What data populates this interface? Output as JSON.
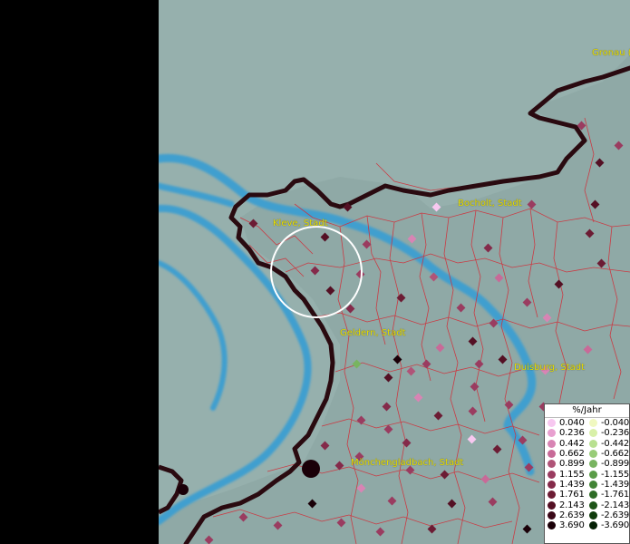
{
  "cities": [
    {
      "name": "Gronau (",
      "pos": "top-right"
    },
    {
      "name": "Bocholt, Stadt"
    },
    {
      "name": "Kleve, Stadt"
    },
    {
      "name": "Geldern, Stadt"
    },
    {
      "name": "Duisburg, Stadt"
    },
    {
      "name": "Mönchengladbach, Stadt"
    }
  ],
  "legend": {
    "title": "%/Jahr",
    "positive": [
      {
        "label": "0.040",
        "color": "#f7c8f0"
      },
      {
        "label": "0.236",
        "color": "#e8a0d0"
      },
      {
        "label": "0.442",
        "color": "#d884b4"
      },
      {
        "label": "0.662",
        "color": "#c86a98"
      },
      {
        "label": "0.899",
        "color": "#b05478"
      },
      {
        "label": "1.155",
        "color": "#9a3c60"
      },
      {
        "label": "1.439",
        "color": "#842a4a"
      },
      {
        "label": "1.761",
        "color": "#6c1c34"
      },
      {
        "label": "2.143",
        "color": "#541024"
      },
      {
        "label": "2.639",
        "color": "#3a0818"
      },
      {
        "label": "3.690",
        "color": "#1a0008"
      }
    ],
    "negative": [
      {
        "label": "-0.040",
        "color": "#f0f8c0"
      },
      {
        "label": "-0.236",
        "color": "#d8f0a8"
      },
      {
        "label": "-0.442",
        "color": "#b8e090"
      },
      {
        "label": "-0.662",
        "color": "#98cc78"
      },
      {
        "label": "-0.899",
        "color": "#78b460"
      },
      {
        "label": "-1.155",
        "color": "#5a9c48"
      },
      {
        "label": "-1.439",
        "color": "#428436"
      },
      {
        "label": "-1.761",
        "color": "#2e6c26"
      },
      {
        "label": "-2.143",
        "color": "#1e5418"
      },
      {
        "label": "-2.639",
        "color": "#103c0c"
      },
      {
        "label": "-3.690",
        "color": "#042004"
      }
    ]
  },
  "colors": {
    "land": "#8fa9a6",
    "water": "#3f9fcf",
    "border": "#2a0a10",
    "district_lines": "#d0303a",
    "label": "#e8e000"
  }
}
